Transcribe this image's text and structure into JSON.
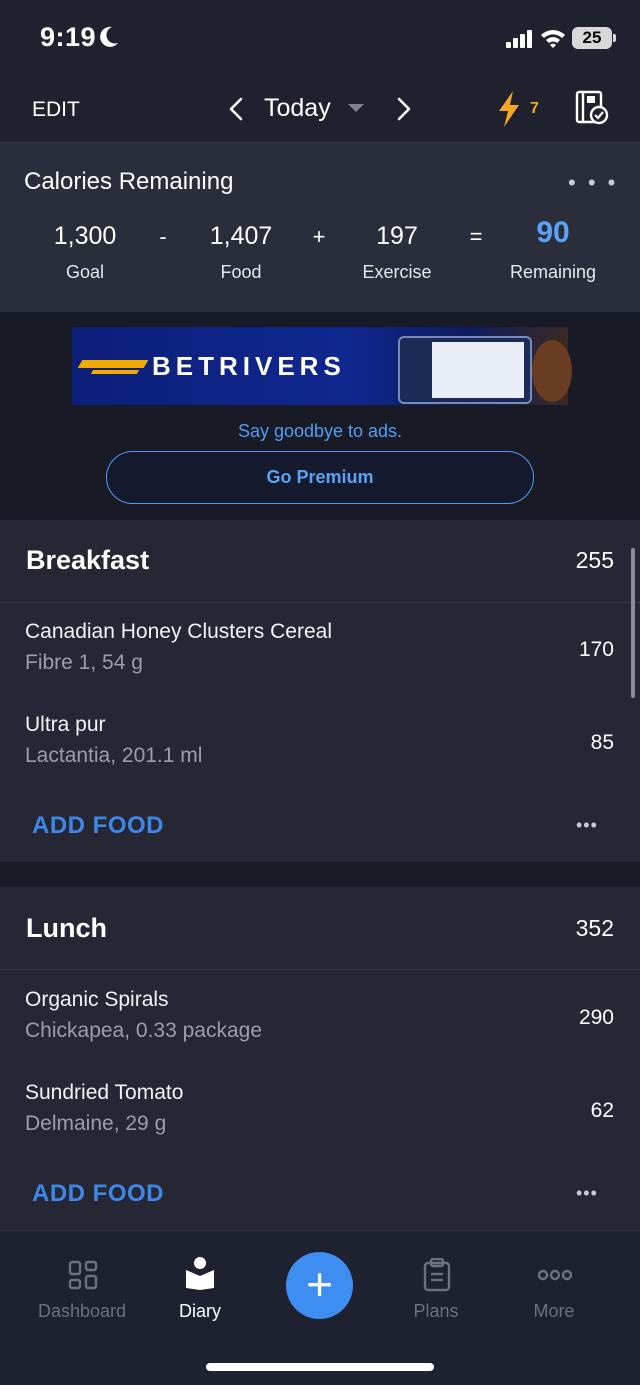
{
  "status_bar": {
    "time": "9:19",
    "battery": "25"
  },
  "nav": {
    "edit_label": "EDIT",
    "date_label": "Today",
    "streak_count": "7"
  },
  "calories": {
    "title": "Calories Remaining",
    "goal_value": "1,300",
    "goal_label": "Goal",
    "minus": "-",
    "food_value": "1,407",
    "food_label": "Food",
    "plus": "+",
    "exercise_value": "197",
    "exercise_label": "Exercise",
    "equals": "=",
    "remaining_value": "90",
    "remaining_label": "Remaining"
  },
  "ad": {
    "brand": "BETRIVERS",
    "note": "Say goodbye to ads.",
    "button_label": "Go Premium"
  },
  "meals": [
    {
      "title": "Breakfast",
      "total": "255",
      "items": [
        {
          "name": "Canadian Honey Clusters Cereal",
          "detail": "Fibre 1, 54 g",
          "calories": "170"
        },
        {
          "name": "Ultra pur",
          "detail": "Lactantia, 201.1 ml",
          "calories": "85"
        }
      ],
      "add_label": "ADD FOOD"
    },
    {
      "title": "Lunch",
      "total": "352",
      "items": [
        {
          "name": "Organic Spirals",
          "detail": "Chickapea, 0.33 package",
          "calories": "290"
        },
        {
          "name": "Sundried Tomato",
          "detail": "Delmaine, 29 g",
          "calories": "62"
        }
      ],
      "add_label": "ADD FOOD"
    }
  ],
  "tabs": [
    {
      "label": "Dashboard",
      "icon": "grid-icon",
      "active": false
    },
    {
      "label": "Diary",
      "icon": "book-icon",
      "active": true
    },
    {
      "label": "Plans",
      "icon": "clipboard-icon",
      "active": false
    },
    {
      "label": "More",
      "icon": "more-icon",
      "active": false
    }
  ],
  "colors": {
    "accent": "#3d8ef0",
    "remaining": "#5aa2f5",
    "streak": "#f5a623",
    "background": "#1f222e"
  }
}
